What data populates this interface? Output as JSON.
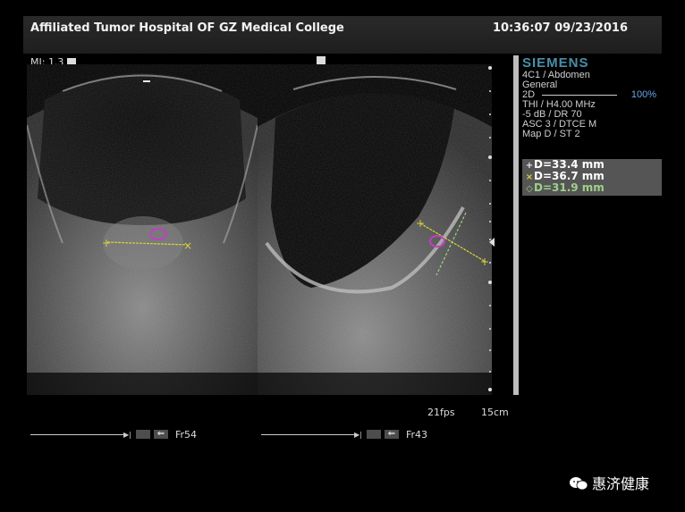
{
  "header": {
    "institution": "Affiliated Tumor Hospital OF GZ Medical College",
    "datetime": "10:36:07 09/23/2016"
  },
  "mi": "MI: 1.3",
  "sidebar": {
    "brand": "SIEMENS",
    "params": [
      "4C1 / Abdomen",
      "General",
      "2D",
      "THI / H4.00 MHz",
      "-5 dB / DR 70",
      "ASC 3 / DTCE M",
      "Map D / ST 2"
    ],
    "power": "100%"
  },
  "measurements": [
    {
      "marker": "+",
      "text": "D=33.4 mm",
      "color": "#e8e8e8"
    },
    {
      "marker": "×",
      "text": "D=36.7 mm",
      "color": "#ffffff"
    },
    {
      "marker": "◇",
      "text": "D=31.9 mm",
      "color": "#9fd18a"
    }
  ],
  "footer": {
    "fps": "21fps",
    "depth": "15cm",
    "left_frame": "Fr54",
    "right_frame": "Fr43"
  },
  "watermark": "惠济健康",
  "colors": {
    "header_bg": "#242424",
    "brand": "#4a8fa8",
    "caliper": "#d6d23a",
    "marker": "#c040c0"
  }
}
